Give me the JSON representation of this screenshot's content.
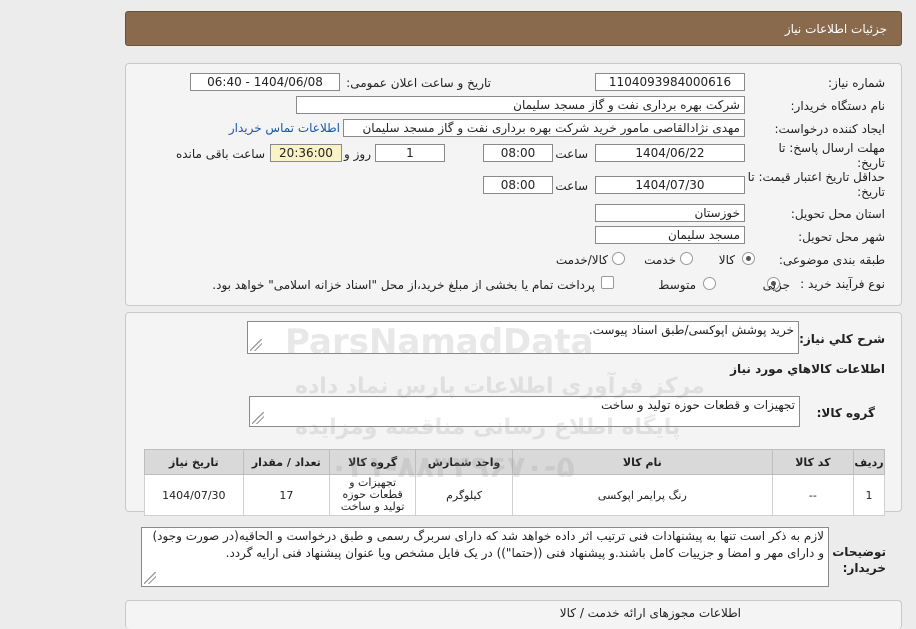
{
  "header": {
    "title": "جزئیات اطلاعات نیاز"
  },
  "form": {
    "need_number": {
      "label": "شماره نیاز:",
      "value": "1104093984000616"
    },
    "announce_datetime": {
      "label": "تاریخ و ساعت اعلان عمومی:",
      "value": "1404/06/08 - 06:40"
    },
    "buyer_org": {
      "label": "نام دستگاه خریدار:",
      "value": "شرکت بهره برداری نفت و گاز مسجد سلیمان"
    },
    "requester": {
      "label": "ایجاد کننده درخواست:",
      "value": "مهدی نژادالقاصی مامور خرید شرکت بهره برداری نفت و گاز مسجد سلیمان",
      "contact_link": "اطلاعات تماس خریدار"
    },
    "reply_deadline": {
      "label": "مهلت ارسال پاسخ: تا تاریخ:",
      "date": "1404/06/22",
      "time_label": "ساعت",
      "time": "08:00",
      "days": "1",
      "days_label": "روز و",
      "remaining_time": "20:36:00",
      "remaining_label": "ساعت باقی مانده"
    },
    "price_validity": {
      "label": "حداقل تاریخ اعتبار قیمت: تا تاریخ:",
      "date": "1404/07/30",
      "time_label": "ساعت",
      "time": "08:00"
    },
    "province": {
      "label": "استان محل تحویل:",
      "value": "خوزستان"
    },
    "city": {
      "label": "شهر محل تحویل:",
      "value": "مسجد سلیمان"
    },
    "category": {
      "label": "طبقه بندی موضوعی:",
      "options": [
        "کالا",
        "خدمت",
        "کالا/خدمت"
      ],
      "selected": 0
    },
    "process": {
      "label": "نوع فرآیند خرید :",
      "options": [
        "جزیی",
        "متوسط"
      ],
      "selected": 0,
      "payment_note": "پرداخت تمام یا بخشی از مبلغ خرید،از محل \"اسناد خزانه اسلامی\" خواهد بود."
    }
  },
  "description": {
    "label": "شرح کلي نياز:",
    "value": "خرید پوشش اپوکسی/طبق اسناد پیوست."
  },
  "goods_section": {
    "title": "اطلاعات کالاهاي مورد نياز"
  },
  "goods_group": {
    "label": "گروه کالا:",
    "value": "تجهیزات و قطعات حوزه تولید و ساخت"
  },
  "table": {
    "headers": [
      "ردیف",
      "کد کالا",
      "نام کالا",
      "واحد شمارش",
      "گروه کالا",
      "تعداد / مقدار",
      "تاریخ نیاز"
    ],
    "rows": [
      [
        "1",
        "--",
        "رنگ پرایمر اپوکسی",
        "کیلوگرم",
        "تجهیزات و قطعات حوزه تولید و ساخت",
        "17",
        "1404/07/30"
      ]
    ]
  },
  "buyer_notes": {
    "label": "توضیحات خریدار:",
    "value": "لازم به ذکر است تنها به پیشنهادات فنی ترتیب اثر داده خواهد شد که دارای سربرگ رسمی و طبق درخواست و الحاقیه(در صورت وجود) و دارای مهر و امضا و جزییات کامل باشند.و پیشنهاد فنی ((حتما\")) در یک فایل مشخص ویا عنوان پیشنهاد فنی ارایه گردد."
  },
  "footer_section": {
    "title": "اطلاعات مجوزهای ارائه خدمت / کالا"
  },
  "watermark": {
    "line1": "ParsNamadData",
    "line2": "مرکز فرآوری اطلاعات پارس نماد داده",
    "line3": "پایگاه اطلاع رسانی مناقصه ومزایده",
    "line4": "۰۲۱-۸۸۳۴۹۶۷۰-۵"
  }
}
